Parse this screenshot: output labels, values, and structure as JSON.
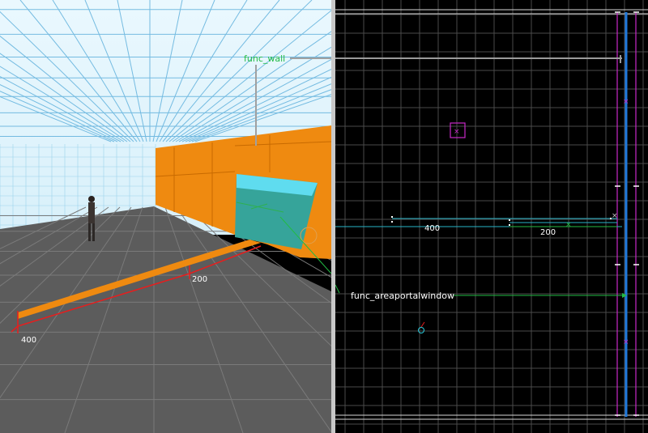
{
  "viewport_3d": {
    "entity_label_wall": "func_wall",
    "entity_label_portal": "func_areaportalwindow",
    "dimension_near": "400",
    "dimension_far": "200",
    "colors": {
      "sky_grid": "#e0f4fc",
      "floor": "#5a5a5a",
      "wall_orange": "#ef8a10",
      "portal_cyan": "#3cd2e6",
      "label_green": "#22bb44",
      "dimension_red": "#e61e1e"
    }
  },
  "viewport_2d": {
    "dimension_left": "400",
    "dimension_right": "200",
    "colors": {
      "background": "#000000",
      "grid": "#4a4a4a",
      "brush_blue": "#1e78dc",
      "selection_magenta": "#c828c8",
      "portal_cyan": "#28b4c8"
    }
  }
}
